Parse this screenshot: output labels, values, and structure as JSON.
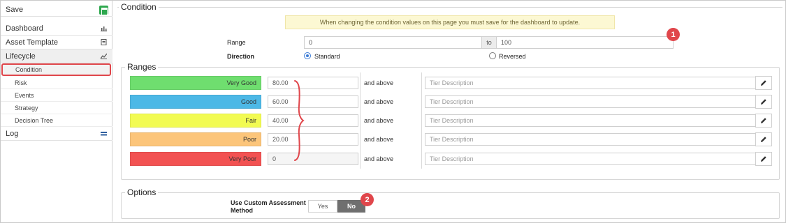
{
  "sidebar": {
    "items": [
      {
        "label": "Save"
      },
      {
        "label": "Dashboard"
      },
      {
        "label": "Asset Template"
      },
      {
        "label": "Lifecycle"
      },
      {
        "label": "Log"
      }
    ],
    "lifecycle_children": [
      {
        "label": "Condition"
      },
      {
        "label": "Risk"
      },
      {
        "label": "Events"
      },
      {
        "label": "Strategy"
      },
      {
        "label": "Decision Tree"
      }
    ]
  },
  "condition": {
    "title": "Condition",
    "notice": "When changing the condition values on this page you must save for the dashboard to update.",
    "range_label": "Range",
    "range_from": "0",
    "range_to_label": "to",
    "range_to": "100",
    "direction_label": "Direction",
    "direction_options": [
      "Standard",
      "Reversed"
    ],
    "direction_selected": "Standard"
  },
  "ranges": {
    "title": "Ranges",
    "and_above_label": "and above",
    "description_placeholder": "Tier Description",
    "tiers": [
      {
        "name": "Very Good",
        "value": "80.00",
        "color": "#6fde6f"
      },
      {
        "name": "Good",
        "value": "60.00",
        "color": "#4cb8e6"
      },
      {
        "name": "Fair",
        "value": "40.00",
        "color": "#f2fb52"
      },
      {
        "name": "Poor",
        "value": "20.00",
        "color": "#fcc57a"
      },
      {
        "name": "Very Poor",
        "value": "0",
        "color": "#f25252"
      }
    ]
  },
  "options": {
    "title": "Options",
    "custom_assessment_label": "Use Custom Assessment Method",
    "yes_label": "Yes",
    "no_label": "No",
    "selected": "No"
  },
  "callouts": [
    "1",
    "2"
  ],
  "colors": {
    "accent": "#e0464b",
    "save_green": "#2fa84f"
  }
}
